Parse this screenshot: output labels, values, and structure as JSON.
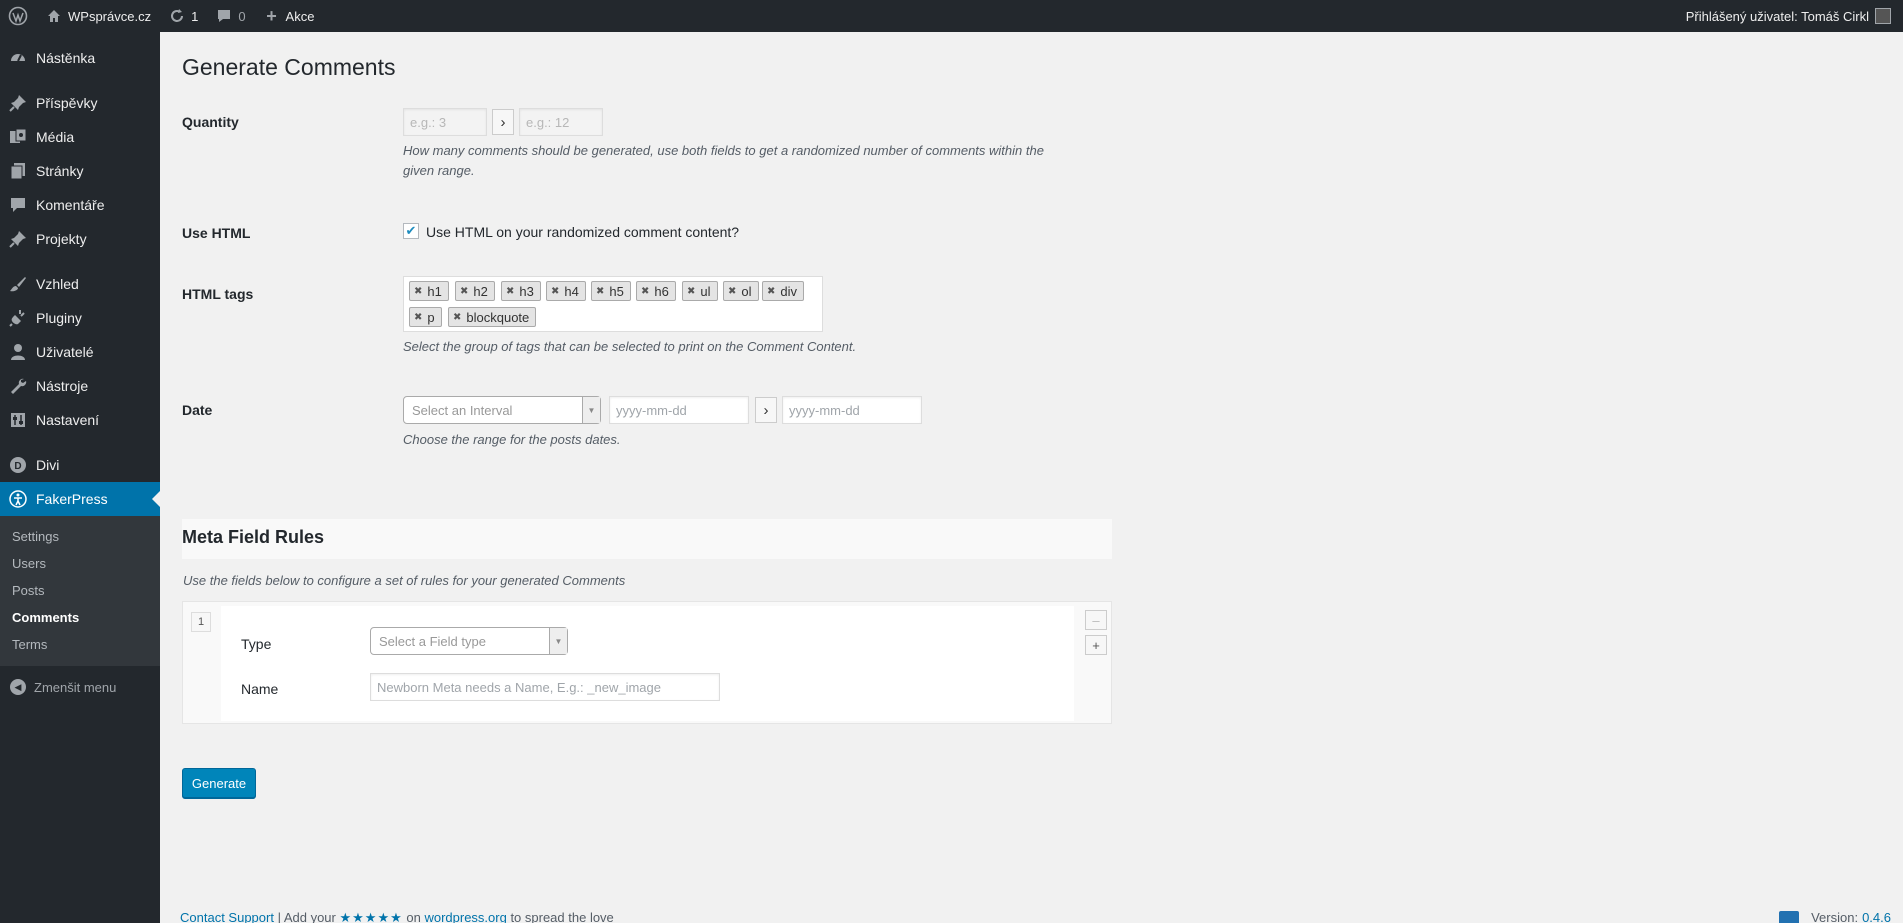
{
  "adminbar": {
    "site_name": "WPsprávce.cz",
    "updates_count": "1",
    "comments_count": "0",
    "new_label": "Akce",
    "user_greeting": "Přihlášený uživatel: Tomáš Cirkl"
  },
  "sidebar": {
    "items": [
      {
        "label": "Nástěnka",
        "icon": "dashboard-icon"
      },
      {
        "label": "Příspěvky",
        "icon": "pin-icon"
      },
      {
        "label": "Média",
        "icon": "media-icon"
      },
      {
        "label": "Stránky",
        "icon": "pages-icon"
      },
      {
        "label": "Komentáře",
        "icon": "comment-icon"
      },
      {
        "label": "Projekty",
        "icon": "pin-icon"
      },
      {
        "label": "Vzhled",
        "icon": "brush-icon"
      },
      {
        "label": "Pluginy",
        "icon": "plugin-icon"
      },
      {
        "label": "Uživatelé",
        "icon": "user-icon"
      },
      {
        "label": "Nástroje",
        "icon": "wrench-icon"
      },
      {
        "label": "Nastavení",
        "icon": "settings-icon"
      },
      {
        "label": "Divi",
        "icon": "divi-icon"
      },
      {
        "label": "FakerPress",
        "icon": "fakerpress-icon"
      }
    ],
    "submenu": [
      "Settings",
      "Users",
      "Posts",
      "Comments",
      "Terms"
    ],
    "collapse_label": "Zmenšit menu"
  },
  "page": {
    "title": "Generate Comments",
    "quantity": {
      "label": "Quantity",
      "min_placeholder": "e.g.: 3",
      "max_placeholder": "e.g.: 12",
      "description_line1": "How many comments should be generated, use both fields to get a randomized number of comments within the",
      "description_line2": "given range."
    },
    "use_html": {
      "label": "Use HTML",
      "checkbox_label": "Use HTML on your randomized comment content?",
      "checked": true
    },
    "html_tags": {
      "label": "HTML tags",
      "tags": [
        "h1",
        "h2",
        "h3",
        "h4",
        "h5",
        "h6",
        "ul",
        "ol",
        "div",
        "p",
        "blockquote"
      ],
      "description": "Select the group of tags that can be selected to print on the Comment Content."
    },
    "date": {
      "label": "Date",
      "interval_placeholder": "Select an Interval",
      "from_placeholder": "yyyy-mm-dd",
      "to_placeholder": "yyyy-mm-dd",
      "description": "Choose the range for the posts dates."
    },
    "meta": {
      "title": "Meta Field Rules",
      "description": "Use the fields below to configure a set of rules for your generated Comments",
      "row_number": "1",
      "type_label": "Type",
      "type_placeholder": "Select a Field type",
      "name_label": "Name",
      "name_placeholder": "Newborn Meta needs a Name, E.g.: _new_image",
      "remove_symbol": "–",
      "add_symbol": "+"
    },
    "generate_label": "Generate"
  },
  "footer": {
    "support_link": "Contact Support",
    "sep": " | Add your ",
    "stars": "★★★★★",
    "on": " on ",
    "wp_link": "wordpress.org",
    "tail": " to spread the love",
    "version_label": "Version:",
    "version_value": "0.4.6"
  },
  "colors": {
    "accent": "#0073aa",
    "primary_button": "#0085ba",
    "sidebar_bg": "#23282d",
    "page_bg": "#f1f1f1"
  }
}
